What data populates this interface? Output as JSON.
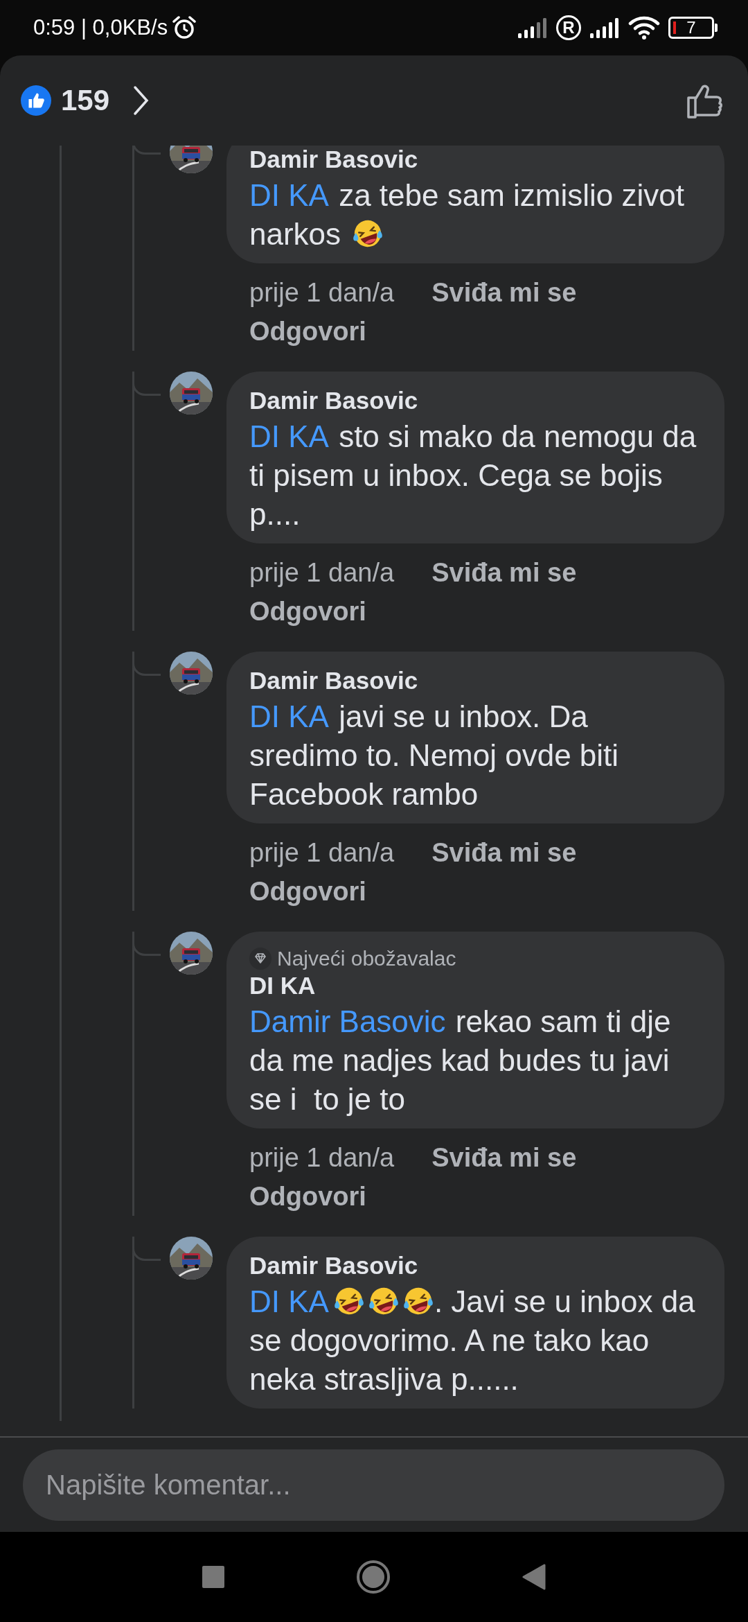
{
  "status_bar": {
    "time": "0:59 | 0,0KB/s",
    "roaming": "R",
    "battery": "7"
  },
  "header": {
    "reaction_count": "159"
  },
  "comments": [
    {
      "author": "Damir Basovic",
      "body": [
        {
          "kind": "mention",
          "text": "DI KA"
        },
        {
          "kind": "text",
          "text": " za tebe sam izmislio zivot narkos "
        },
        {
          "kind": "emoji"
        }
      ],
      "meta": {
        "time": "prije 1 dan/a",
        "like": "Sviđa mi se",
        "reply": "Odgovori"
      }
    },
    {
      "author": "Damir Basovic",
      "body": [
        {
          "kind": "mention",
          "text": "DI KA"
        },
        {
          "kind": "text",
          "text": " sto si mako da nemogu da ti pisem u inbox. Cega se bojis p...."
        }
      ],
      "meta": {
        "time": "prije 1 dan/a",
        "like": "Sviđa mi se",
        "reply": "Odgovori"
      }
    },
    {
      "author": "Damir Basovic",
      "body": [
        {
          "kind": "mention",
          "text": "DI KA"
        },
        {
          "kind": "text",
          "text": " javi se u inbox. Da sredimo to. Nemoj ovde biti Facebook rambo"
        }
      ],
      "meta": {
        "time": "prije 1 dan/a",
        "like": "Sviđa mi se",
        "reply": "Odgovori"
      }
    },
    {
      "author": "DI KA",
      "badge": "Najveći obožavalac",
      "body": [
        {
          "kind": "mention",
          "text": "Damir Basovic"
        },
        {
          "kind": "text",
          "text": " rekao sam ti dje da me nadjes kad budes tu javi se i  to je to"
        }
      ],
      "meta": {
        "time": "prije 1 dan/a",
        "like": "Sviđa mi se",
        "reply": "Odgovori"
      }
    },
    {
      "author": "Damir Basovic",
      "body": [
        {
          "kind": "mention",
          "text": "DI KA"
        },
        {
          "kind": "emoji"
        },
        {
          "kind": "emoji"
        },
        {
          "kind": "emoji"
        },
        {
          "kind": "text",
          "text": ". Javi se u inbox da se dogovorimo. A ne tako kao neka strasljiva p......"
        }
      ]
    }
  ],
  "composer": {
    "placeholder": "Napišite komentar..."
  }
}
